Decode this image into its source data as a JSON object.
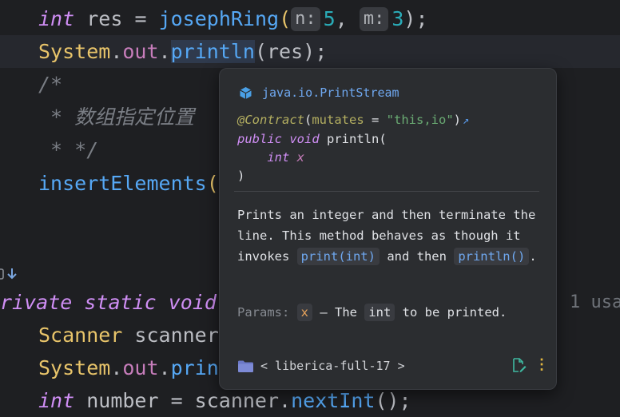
{
  "editor": {
    "line1": {
      "kw": "int",
      "var": "res",
      "eq": "=",
      "fn": "josephRing",
      "paren_open": "(",
      "hint_n": "n:",
      "arg_n": "5",
      "comma": ",",
      "hint_m": "m:",
      "arg_m": "3",
      "tail": ");"
    },
    "line2": {
      "cls": "System",
      "dot1": ".",
      "field": "out",
      "dot2": ".",
      "fn": "println",
      "args": "(res);"
    },
    "line3": {
      "comment": "/*"
    },
    "line4": {
      "comment": " * 数组指定位置"
    },
    "line5": {
      "comment": " * */"
    },
    "line6": {
      "fn": "insertElements",
      "paren": "("
    },
    "line8": {
      "kw": "rivate static void",
      "usage": "1 usa"
    },
    "line9": {
      "type": "Scanner",
      "var": "scanner"
    },
    "line10": {
      "cls": "System",
      "dot1": ".",
      "field": "out",
      "dot2": ".",
      "fn": "prin"
    },
    "line11": {
      "kw": "int",
      "rest": "number = scanner.",
      "fn": "nextInt",
      "tail": "();"
    }
  },
  "popup": {
    "package": "java.io.PrintStream",
    "signature": {
      "annotation": "@Contract",
      "attr_name": "mutates",
      "attr_eq": " = ",
      "attr_value": "\"this,io\"",
      "close_paren": ")",
      "modifiers": "public void",
      "method": "println",
      "open_paren": "(",
      "param_type": "int",
      "param_name": "x",
      "end": ")"
    },
    "description": {
      "part1": "Prints an integer and then terminate the line. This method behaves as though it invokes ",
      "code1": "print(int)",
      "part2": " and then ",
      "code2": "println()",
      "part3": "."
    },
    "params": {
      "label": "Params:",
      "name": "x",
      "text1": " – The ",
      "type": "int",
      "text2": " to be printed."
    },
    "library": "< liberica-full-17 >"
  },
  "colors": {
    "background": "#1e1f22",
    "popup_bg": "#2b2d30",
    "keyword": "#cf8ef4",
    "function": "#56a8f5",
    "class": "#e8c46a",
    "accent_blue": "#6fa8f0",
    "more_icon": "#e3b740"
  }
}
